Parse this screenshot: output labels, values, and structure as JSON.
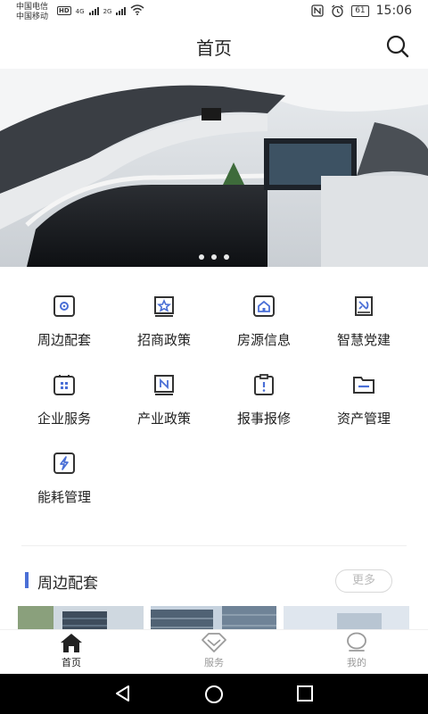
{
  "status_bar": {
    "carrier1": "中国电信",
    "carrier2": "中国移动",
    "hd": "HD",
    "net1": "4G",
    "net2": "2G",
    "battery": "61",
    "time": "15:06"
  },
  "header": {
    "title": "首页",
    "search_icon": "search-icon"
  },
  "banner": {
    "slides": 3,
    "active_slide": 1
  },
  "grid": {
    "items": [
      {
        "label": "周边配套",
        "icon": "nearby-icon"
      },
      {
        "label": "招商政策",
        "icon": "investment-policy-icon"
      },
      {
        "label": "房源信息",
        "icon": "house-icon"
      },
      {
        "label": "智慧党建",
        "icon": "party-building-icon"
      },
      {
        "label": "企业服务",
        "icon": "enterprise-service-icon"
      },
      {
        "label": "产业政策",
        "icon": "industry-policy-icon"
      },
      {
        "label": "报事报修",
        "icon": "report-repair-icon"
      },
      {
        "label": "资产管理",
        "icon": "asset-management-icon"
      },
      {
        "label": "能耗管理",
        "icon": "energy-icon"
      }
    ]
  },
  "section": {
    "title": "周边配套",
    "more": "更多"
  },
  "tabbar": {
    "items": [
      {
        "label": "首页",
        "active": true
      },
      {
        "label": "服务",
        "active": false
      },
      {
        "label": "我的",
        "active": false
      }
    ]
  },
  "colors": {
    "accent": "#4a6fd6",
    "icon_stroke": "#333333",
    "icon_fill": "#4a6fd6"
  }
}
